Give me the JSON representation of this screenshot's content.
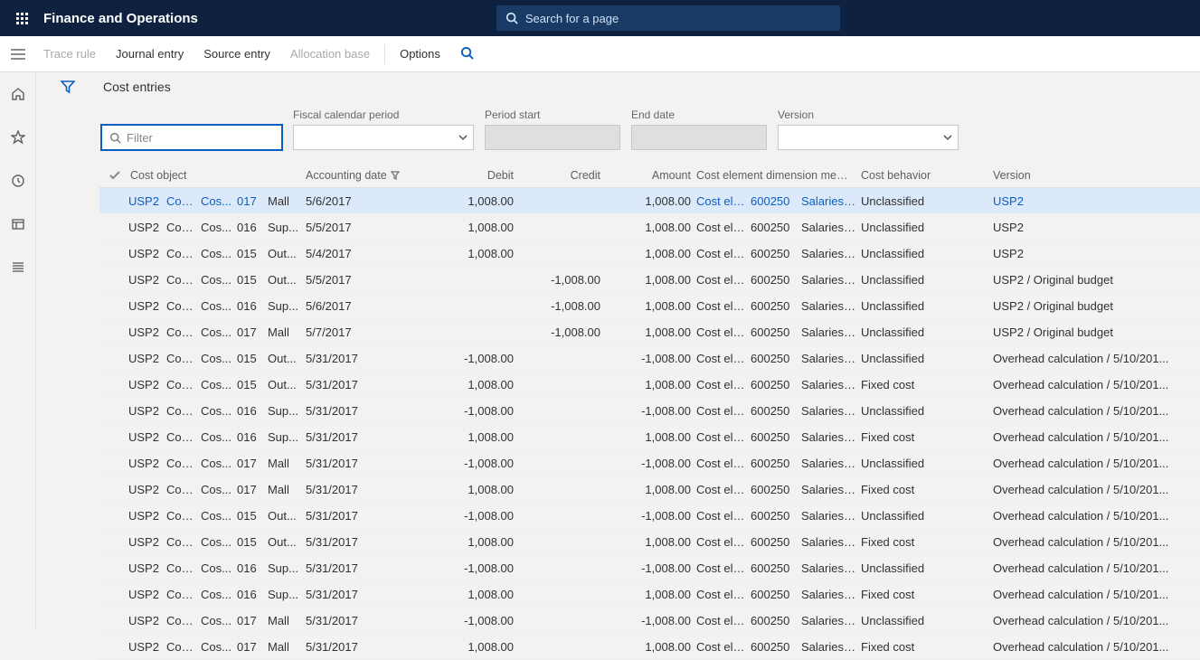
{
  "app": {
    "title": "Finance and Operations"
  },
  "search": {
    "placeholder": "Search for a page"
  },
  "commands": {
    "trace_rule": "Trace rule",
    "journal_entry": "Journal entry",
    "source_entry": "Source entry",
    "allocation_base": "Allocation base",
    "options": "Options"
  },
  "page": {
    "title": "Cost entries"
  },
  "filters": {
    "filter_placeholder": "Filter",
    "fiscal_period_label": "Fiscal calendar period",
    "period_start_label": "Period start",
    "end_date_label": "End date",
    "version_label": "Version"
  },
  "columns": {
    "cost_object": "Cost object",
    "accounting_date": "Accounting date",
    "debit": "Debit",
    "credit": "Credit",
    "amount": "Amount",
    "cem": "Cost element dimension member",
    "behavior": "Cost behavior",
    "version": "Version"
  },
  "rows": [
    {
      "co1": "USP2",
      "co2": "Cos...",
      "co3": "Cos...",
      "co4": "017",
      "co5": "Mall",
      "date": "5/6/2017",
      "debit": "1,008.00",
      "credit": "",
      "amount": "1,008.00",
      "cem1": "Cost ele...",
      "cem2": "600250",
      "cem3": "Salaries ...",
      "behav": "Unclassified",
      "ver": "USP2",
      "selected": true
    },
    {
      "co1": "USP2",
      "co2": "Cos...",
      "co3": "Cos...",
      "co4": "016",
      "co5": "Sup...",
      "date": "5/5/2017",
      "debit": "1,008.00",
      "credit": "",
      "amount": "1,008.00",
      "cem1": "Cost ele...",
      "cem2": "600250",
      "cem3": "Salaries ...",
      "behav": "Unclassified",
      "ver": "USP2"
    },
    {
      "co1": "USP2",
      "co2": "Cos...",
      "co3": "Cos...",
      "co4": "015",
      "co5": "Out...",
      "date": "5/4/2017",
      "debit": "1,008.00",
      "credit": "",
      "amount": "1,008.00",
      "cem1": "Cost ele...",
      "cem2": "600250",
      "cem3": "Salaries ...",
      "behav": "Unclassified",
      "ver": "USP2"
    },
    {
      "co1": "USP2",
      "co2": "Cos...",
      "co3": "Cos...",
      "co4": "015",
      "co5": "Out...",
      "date": "5/5/2017",
      "debit": "",
      "credit": "-1,008.00",
      "amount": "1,008.00",
      "cem1": "Cost ele...",
      "cem2": "600250",
      "cem3": "Salaries ...",
      "behav": "Unclassified",
      "ver": "USP2 / Original budget"
    },
    {
      "co1": "USP2",
      "co2": "Cos...",
      "co3": "Cos...",
      "co4": "016",
      "co5": "Sup...",
      "date": "5/6/2017",
      "debit": "",
      "credit": "-1,008.00",
      "amount": "1,008.00",
      "cem1": "Cost ele...",
      "cem2": "600250",
      "cem3": "Salaries ...",
      "behav": "Unclassified",
      "ver": "USP2 / Original budget"
    },
    {
      "co1": "USP2",
      "co2": "Cos...",
      "co3": "Cos...",
      "co4": "017",
      "co5": "Mall",
      "date": "5/7/2017",
      "debit": "",
      "credit": "-1,008.00",
      "amount": "1,008.00",
      "cem1": "Cost ele...",
      "cem2": "600250",
      "cem3": "Salaries ...",
      "behav": "Unclassified",
      "ver": "USP2 / Original budget"
    },
    {
      "co1": "USP2",
      "co2": "Cos...",
      "co3": "Cos...",
      "co4": "015",
      "co5": "Out...",
      "date": "5/31/2017",
      "debit": "-1,008.00",
      "credit": "",
      "amount": "-1,008.00",
      "cem1": "Cost ele...",
      "cem2": "600250",
      "cem3": "Salaries ...",
      "behav": "Unclassified",
      "ver": "Overhead calculation / 5/10/201..."
    },
    {
      "co1": "USP2",
      "co2": "Cos...",
      "co3": "Cos...",
      "co4": "015",
      "co5": "Out...",
      "date": "5/31/2017",
      "debit": "1,008.00",
      "credit": "",
      "amount": "1,008.00",
      "cem1": "Cost ele...",
      "cem2": "600250",
      "cem3": "Salaries ...",
      "behav": "Fixed cost",
      "ver": "Overhead calculation / 5/10/201..."
    },
    {
      "co1": "USP2",
      "co2": "Cos...",
      "co3": "Cos...",
      "co4": "016",
      "co5": "Sup...",
      "date": "5/31/2017",
      "debit": "-1,008.00",
      "credit": "",
      "amount": "-1,008.00",
      "cem1": "Cost ele...",
      "cem2": "600250",
      "cem3": "Salaries ...",
      "behav": "Unclassified",
      "ver": "Overhead calculation / 5/10/201..."
    },
    {
      "co1": "USP2",
      "co2": "Cos...",
      "co3": "Cos...",
      "co4": "016",
      "co5": "Sup...",
      "date": "5/31/2017",
      "debit": "1,008.00",
      "credit": "",
      "amount": "1,008.00",
      "cem1": "Cost ele...",
      "cem2": "600250",
      "cem3": "Salaries ...",
      "behav": "Fixed cost",
      "ver": "Overhead calculation / 5/10/201..."
    },
    {
      "co1": "USP2",
      "co2": "Cos...",
      "co3": "Cos...",
      "co4": "017",
      "co5": "Mall",
      "date": "5/31/2017",
      "debit": "-1,008.00",
      "credit": "",
      "amount": "-1,008.00",
      "cem1": "Cost ele...",
      "cem2": "600250",
      "cem3": "Salaries ...",
      "behav": "Unclassified",
      "ver": "Overhead calculation / 5/10/201..."
    },
    {
      "co1": "USP2",
      "co2": "Cos...",
      "co3": "Cos...",
      "co4": "017",
      "co5": "Mall",
      "date": "5/31/2017",
      "debit": "1,008.00",
      "credit": "",
      "amount": "1,008.00",
      "cem1": "Cost ele...",
      "cem2": "600250",
      "cem3": "Salaries ...",
      "behav": "Fixed cost",
      "ver": "Overhead calculation / 5/10/201..."
    },
    {
      "co1": "USP2",
      "co2": "Cos...",
      "co3": "Cos...",
      "co4": "015",
      "co5": "Out...",
      "date": "5/31/2017",
      "debit": "-1,008.00",
      "credit": "",
      "amount": "-1,008.00",
      "cem1": "Cost ele...",
      "cem2": "600250",
      "cem3": "Salaries ...",
      "behav": "Unclassified",
      "ver": "Overhead calculation / 5/10/201..."
    },
    {
      "co1": "USP2",
      "co2": "Cos...",
      "co3": "Cos...",
      "co4": "015",
      "co5": "Out...",
      "date": "5/31/2017",
      "debit": "1,008.00",
      "credit": "",
      "amount": "1,008.00",
      "cem1": "Cost ele...",
      "cem2": "600250",
      "cem3": "Salaries ...",
      "behav": "Fixed cost",
      "ver": "Overhead calculation / 5/10/201..."
    },
    {
      "co1": "USP2",
      "co2": "Cos...",
      "co3": "Cos...",
      "co4": "016",
      "co5": "Sup...",
      "date": "5/31/2017",
      "debit": "-1,008.00",
      "credit": "",
      "amount": "-1,008.00",
      "cem1": "Cost ele...",
      "cem2": "600250",
      "cem3": "Salaries ...",
      "behav": "Unclassified",
      "ver": "Overhead calculation / 5/10/201..."
    },
    {
      "co1": "USP2",
      "co2": "Cos...",
      "co3": "Cos...",
      "co4": "016",
      "co5": "Sup...",
      "date": "5/31/2017",
      "debit": "1,008.00",
      "credit": "",
      "amount": "1,008.00",
      "cem1": "Cost ele...",
      "cem2": "600250",
      "cem3": "Salaries ...",
      "behav": "Fixed cost",
      "ver": "Overhead calculation / 5/10/201..."
    },
    {
      "co1": "USP2",
      "co2": "Cos...",
      "co3": "Cos...",
      "co4": "017",
      "co5": "Mall",
      "date": "5/31/2017",
      "debit": "-1,008.00",
      "credit": "",
      "amount": "-1,008.00",
      "cem1": "Cost ele...",
      "cem2": "600250",
      "cem3": "Salaries ...",
      "behav": "Unclassified",
      "ver": "Overhead calculation / 5/10/201..."
    },
    {
      "co1": "USP2",
      "co2": "Cos...",
      "co3": "Cos...",
      "co4": "017",
      "co5": "Mall",
      "date": "5/31/2017",
      "debit": "1,008.00",
      "credit": "",
      "amount": "1,008.00",
      "cem1": "Cost ele...",
      "cem2": "600250",
      "cem3": "Salaries ...",
      "behav": "Fixed cost",
      "ver": "Overhead calculation / 5/10/201..."
    }
  ]
}
